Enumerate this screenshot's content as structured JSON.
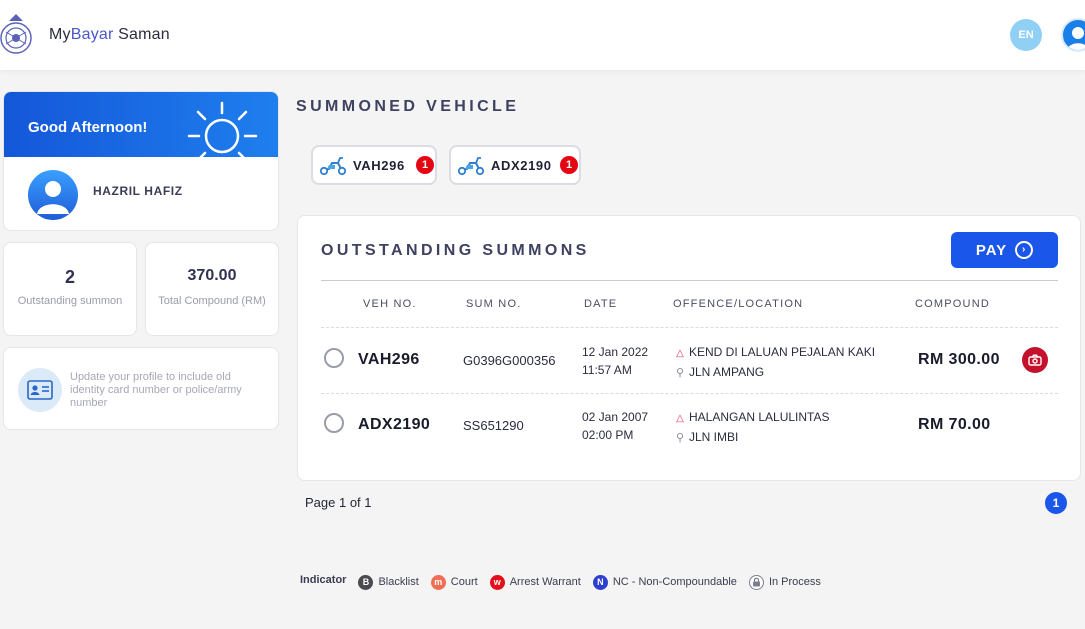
{
  "header": {
    "brand_prefix": "My",
    "brand_accent": "Bayar",
    "brand_suffix": " Saman",
    "language": "EN",
    "accent_color": "#1a56ea"
  },
  "greeting": {
    "text": "Good Afternoon!",
    "user_name": "HAZRIL HAFIZ",
    "banner_colors": [
      "#1457d9",
      "#1f7fee"
    ]
  },
  "stats": [
    {
      "value": "2",
      "label": "Outstanding summon"
    },
    {
      "value": "370.00",
      "label": "Total Compound (RM)"
    }
  ],
  "profile_notice": {
    "text": "Update your profile to include old identity card number or police/army number",
    "icon": "id-card-icon"
  },
  "summoned_vehicle": {
    "title": "SUMMONED VEHICLE",
    "vehicles": [
      {
        "plate": "VAH296",
        "count": "1",
        "icon": "scooter-icon"
      },
      {
        "plate": "ADX2190",
        "count": "1",
        "icon": "scooter-icon"
      }
    ]
  },
  "outstanding": {
    "title": "OUTSTANDING SUMMONS",
    "pay_label": "PAY",
    "columns": [
      "VEH NO.",
      "SUM NO.",
      "DATE",
      "OFFENCE/LOCATION",
      "COMPOUND"
    ],
    "rows": [
      {
        "veh_no": "VAH296",
        "sum_no": "G0396G000356",
        "date": "12 Jan 2022",
        "time": "11:57 AM",
        "offence": "KEND DI LALUAN PEJALAN KAKI",
        "location": "JLN AMPANG",
        "compound": "RM 300.00",
        "has_photo": true
      },
      {
        "veh_no": "ADX2190",
        "sum_no": "SS651290",
        "date": "02 Jan 2007",
        "time": "02:00 PM",
        "offence": "HALANGAN LALULINTAS",
        "location": "JLN IMBI",
        "compound": "RM 70.00",
        "has_photo": false
      }
    ]
  },
  "pagination": {
    "info": "Page 1 of 1",
    "current": "1"
  },
  "indicator": {
    "title": "Indicator",
    "items": [
      {
        "letter": "B",
        "label": "Blacklist",
        "color": "#4a4a4f"
      },
      {
        "letter": "m",
        "label": "Court",
        "color": "#f06e53"
      },
      {
        "letter": "w",
        "label": "Arrest Warrant",
        "color": "#e3101c"
      },
      {
        "letter": "N",
        "label": "NC - Non-Compoundable",
        "color": "#2d3fcf"
      },
      {
        "letter": "",
        "label": "In Process",
        "color": "#7d7f8c"
      }
    ]
  }
}
